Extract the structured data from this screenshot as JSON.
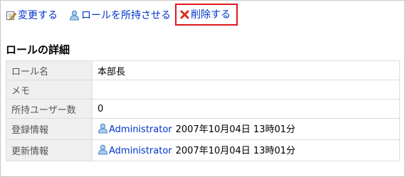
{
  "toolbar": {
    "edit_label": "変更する",
    "assign_label": "ロールを所持させる",
    "delete_label": "削除する"
  },
  "section": {
    "title": "ロールの詳細"
  },
  "details": {
    "role_name": {
      "label": "ロール名",
      "value": "本部長"
    },
    "memo": {
      "label": "メモ",
      "value": ""
    },
    "user_count": {
      "label": "所持ユーザー数",
      "value": "0"
    },
    "registered": {
      "label": "登録情報",
      "user": "Administrator",
      "datetime": "2007年10月04日 13時01分"
    },
    "updated": {
      "label": "更新情報",
      "user": "Administrator",
      "datetime": "2007年10月04日 13時01分"
    }
  },
  "colors": {
    "link": "#0033cc",
    "highlight_border": "#e0161b",
    "label_bg": "#efefef",
    "delete_icon": "#d9301f"
  }
}
